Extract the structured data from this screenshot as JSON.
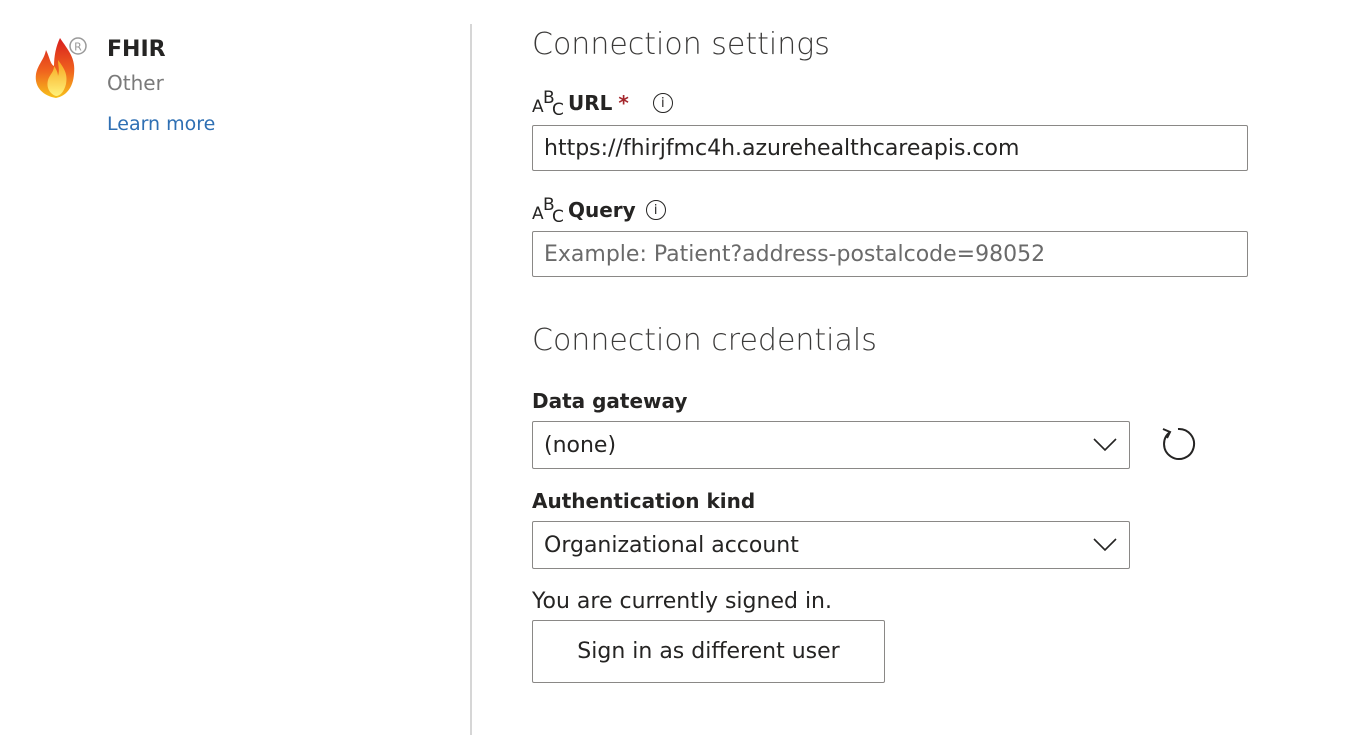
{
  "connector": {
    "name": "FHIR",
    "category": "Other",
    "learn_more": "Learn more",
    "logo_icon": "fhir-flame-logo"
  },
  "connection_settings": {
    "title": "Connection settings",
    "url": {
      "type_icon_letters": [
        "A",
        "B",
        "C"
      ],
      "label": "URL",
      "required_marker": "*",
      "info_icon": "i",
      "value": "https://fhirjfmc4h.azurehealthcareapis.com"
    },
    "query": {
      "type_icon_letters": [
        "A",
        "B",
        "C"
      ],
      "label": "Query",
      "info_icon": "i",
      "value": "",
      "placeholder": "Example: Patient?address-postalcode=98052"
    }
  },
  "connection_credentials": {
    "title": "Connection credentials",
    "data_gateway": {
      "label": "Data gateway",
      "selected": "(none)"
    },
    "authentication_kind": {
      "label": "Authentication kind",
      "selected": "Organizational account"
    },
    "status": "You are currently signed in.",
    "sign_in_button": "Sign in as different user"
  },
  "colors": {
    "required": "#a4262c",
    "link": "#2e6fb3",
    "border": "#8a8886",
    "divider": "#d6d6d6"
  }
}
